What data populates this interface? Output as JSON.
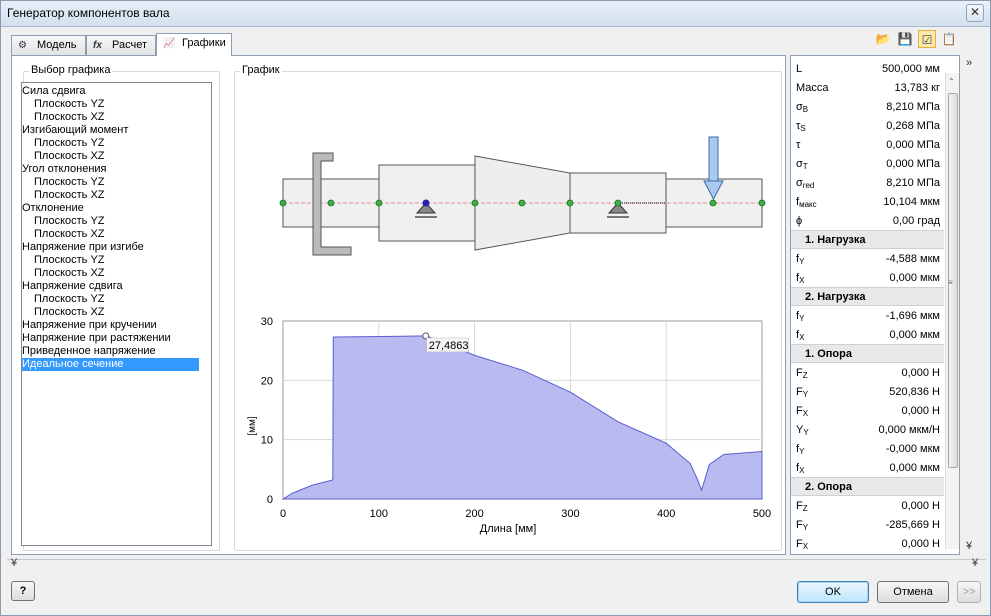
{
  "window": {
    "title": "Генератор компонентов вала",
    "close_glyph": "✕"
  },
  "tabs": [
    {
      "label": "Модель",
      "icon": "shaft-model-icon",
      "glyph": "⚙"
    },
    {
      "label": "Расчет",
      "icon": "function-icon",
      "glyph": "fx"
    },
    {
      "label": "Графики",
      "icon": "graph-icon",
      "glyph": "📈"
    }
  ],
  "toolbar": {
    "open_glyph": "📂",
    "save_glyph": "💾",
    "options_glyph": "☑",
    "report_glyph": "📋"
  },
  "graph_select": {
    "label": "Выбор графика",
    "items": [
      {
        "label": "Сила сдвига",
        "level": 1
      },
      {
        "label": "Плоскость YZ",
        "level": 2
      },
      {
        "label": "Плоскость XZ",
        "level": 2
      },
      {
        "label": "Изгибающий момент",
        "level": 1
      },
      {
        "label": "Плоскость YZ",
        "level": 2
      },
      {
        "label": "Плоскость XZ",
        "level": 2
      },
      {
        "label": "Угол отклонения",
        "level": 1
      },
      {
        "label": "Плоскость YZ",
        "level": 2
      },
      {
        "label": "Плоскость XZ",
        "level": 2
      },
      {
        "label": "Отклонение",
        "level": 1
      },
      {
        "label": "Плоскость YZ",
        "level": 2
      },
      {
        "label": "Плоскость XZ",
        "level": 2
      },
      {
        "label": "Напряжение при изгибе",
        "level": 1
      },
      {
        "label": "Плоскость YZ",
        "level": 2
      },
      {
        "label": "Плоскость XZ",
        "level": 2
      },
      {
        "label": "Напряжение сдвига",
        "level": 1
      },
      {
        "label": "Плоскость YZ",
        "level": 2
      },
      {
        "label": "Плоскость XZ",
        "level": 2
      },
      {
        "label": "Напряжение при кручении",
        "level": 1
      },
      {
        "label": "Напряжение при растяжении",
        "level": 1
      },
      {
        "label": "Приведенное напряжение",
        "level": 1
      },
      {
        "label": "Идеальное сечение",
        "level": 1,
        "selected": true
      }
    ]
  },
  "graph": {
    "label": "График"
  },
  "chart_data": {
    "type": "area",
    "title": "",
    "xlabel": "Длина [мм]",
    "ylabel": "[мм]",
    "xlim": [
      0,
      500
    ],
    "ylim": [
      0,
      30
    ],
    "xticks": [
      "0",
      "100",
      "200",
      "300",
      "400",
      "500"
    ],
    "yticks": [
      "0",
      "10",
      "20",
      "30"
    ],
    "grid": true,
    "fill_color": "#b8baf0",
    "line_color": "#5a5ed0",
    "annotation": {
      "x": 149,
      "y": 27.4863,
      "label": "27,4863"
    },
    "x": [
      0,
      10,
      30,
      52,
      52.5,
      115,
      150,
      200,
      250,
      300,
      350,
      400,
      425,
      432,
      437,
      445,
      460,
      500
    ],
    "y": [
      0,
      1.0,
      2.3,
      3.2,
      27.3,
      27.4,
      27.4863,
      24.2,
      21.7,
      18.0,
      13.0,
      9.4,
      6.0,
      3.5,
      1.5,
      5.8,
      7.5,
      8.0
    ]
  },
  "properties": {
    "rows": [
      {
        "type": "row",
        "k": "L",
        "sub": "",
        "v": "500,000 мм"
      },
      {
        "type": "row",
        "k": "Масса",
        "sub": "",
        "v": "13,783 кг"
      },
      {
        "type": "row",
        "k": "σ",
        "sub": "B",
        "v": "8,210 МПа"
      },
      {
        "type": "row",
        "k": "τ",
        "sub": "S",
        "v": "0,268 МПа"
      },
      {
        "type": "row",
        "k": "τ",
        "sub": "",
        "v": "0,000 МПа"
      },
      {
        "type": "row",
        "k": "σ",
        "sub": "T",
        "v": "0,000 МПа"
      },
      {
        "type": "row",
        "k": "σ",
        "sub": "red",
        "v": "8,210 МПа"
      },
      {
        "type": "row",
        "k": "f",
        "sub": "макс",
        "v": "10,104 мкм"
      },
      {
        "type": "row",
        "k": "ϕ",
        "sub": "",
        "v": "0,00 град"
      },
      {
        "type": "head",
        "k": "1. Нагрузка"
      },
      {
        "type": "row",
        "k": "f",
        "sub": "Y",
        "v": "-4,588 мкм"
      },
      {
        "type": "row",
        "k": "f",
        "sub": "X",
        "v": "0,000 мкм"
      },
      {
        "type": "head",
        "k": "2. Нагрузка"
      },
      {
        "type": "row",
        "k": "f",
        "sub": "Y",
        "v": "-1,696 мкм"
      },
      {
        "type": "row",
        "k": "f",
        "sub": "X",
        "v": "0,000 мкм"
      },
      {
        "type": "head",
        "k": "1. Опора"
      },
      {
        "type": "row",
        "k": "F",
        "sub": "Z",
        "v": "0,000 Н"
      },
      {
        "type": "row",
        "k": "F",
        "sub": "Y",
        "v": "520,836 Н"
      },
      {
        "type": "row",
        "k": "F",
        "sub": "X",
        "v": "0,000 Н"
      },
      {
        "type": "row",
        "k": "Y",
        "sub": "Y",
        "v": "0,000 мкм/Н"
      },
      {
        "type": "row",
        "k": "f",
        "sub": "Y",
        "v": "-0,000 мкм"
      },
      {
        "type": "row",
        "k": "f",
        "sub": "X",
        "v": "0,000 мкм"
      },
      {
        "type": "head",
        "k": "2. Опора"
      },
      {
        "type": "row",
        "k": "F",
        "sub": "Z",
        "v": "0,000 Н"
      },
      {
        "type": "row",
        "k": "F",
        "sub": "Y",
        "v": "-285,669 Н"
      },
      {
        "type": "row",
        "k": "F",
        "sub": "X",
        "v": "0,000 Н"
      }
    ]
  },
  "chevrons": {
    "right": "»",
    "up": "⌃",
    "down_double": "¥",
    "grip": "≡"
  },
  "footer": {
    "help_glyph": "?",
    "ok_label": "OK",
    "cancel_label": "Отмена",
    "more_label": ">>"
  }
}
